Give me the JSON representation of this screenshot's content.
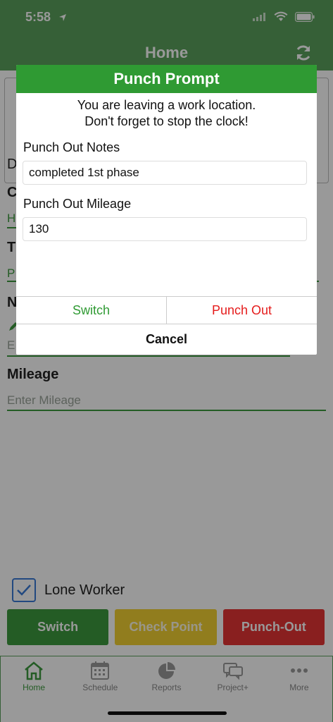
{
  "status_bar": {
    "time": "5:58"
  },
  "header": {
    "title": "Home"
  },
  "form": {
    "mileage_label": "Mileage",
    "mileage_placeholder": "Enter Mileage",
    "lone_worker_label": "Lone Worker"
  },
  "actions": {
    "switch_label": "Switch",
    "check_point_label": "Check Point",
    "punch_out_label": "Punch-Out"
  },
  "tabbar": {
    "items": [
      {
        "label": "Home",
        "icon": "home-icon"
      },
      {
        "label": "Schedule",
        "icon": "calendar-icon"
      },
      {
        "label": "Reports",
        "icon": "pie-chart-icon"
      },
      {
        "label": "Project+",
        "icon": "chat-bubbles-icon"
      },
      {
        "label": "More",
        "icon": "more-dots-icon"
      }
    ]
  },
  "modal": {
    "title": "Punch Prompt",
    "message_line1": "You are leaving a work location.",
    "message_line2": "Don't forget to stop the clock!",
    "notes_label": "Punch Out Notes",
    "notes_value": "completed 1st phase",
    "mileage_label": "Punch Out Mileage",
    "mileage_value": "130",
    "switch_label": "Switch",
    "punch_out_label": "Punch Out",
    "cancel_label": "Cancel"
  },
  "colors": {
    "brand_green": "#5aa15c",
    "modal_green": "#2f9a33",
    "check_point_yellow": "#f2d033",
    "punch_out_red": "#e53535"
  }
}
